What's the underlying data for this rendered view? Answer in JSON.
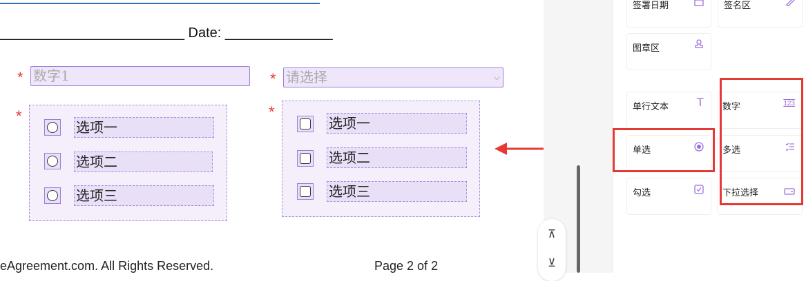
{
  "document": {
    "signature_line": "________________________ Date: ______________",
    "required_mark": "*",
    "number_field": {
      "placeholder": "数字1"
    },
    "select_field": {
      "placeholder": "请选择",
      "chevron": "⌵"
    },
    "radio_group": {
      "options": [
        "选项一",
        "选项二",
        "选项三"
      ]
    },
    "checkbox_group": {
      "options": [
        "选项一",
        "选项二",
        "选项三"
      ]
    },
    "footer": {
      "left": "eAgreement.com. All Rights Reserved.",
      "right": "Page 2 of 2"
    }
  },
  "nav": {
    "top_icon": "⊼",
    "bottom_icon": "⊻"
  },
  "panel": {
    "cards": [
      {
        "label": "签署日期",
        "icon": "calendar-icon"
      },
      {
        "label": "签名区",
        "icon": "pen-icon"
      },
      {
        "label": "图章区",
        "icon": "stamp-icon"
      },
      {
        "label": "单行文本",
        "icon": "text-icon"
      },
      {
        "label": "数字",
        "icon": "number-icon"
      },
      {
        "label": "单选",
        "icon": "radio-icon"
      },
      {
        "label": "多选",
        "icon": "multiselect-icon"
      },
      {
        "label": "勾选",
        "icon": "checkbox-icon"
      },
      {
        "label": "下拉选择",
        "icon": "dropdown-icon"
      }
    ]
  },
  "colors": {
    "accent": "#9b6fe0",
    "highlight": "#e53935",
    "field_bg": "#efe6fb"
  }
}
